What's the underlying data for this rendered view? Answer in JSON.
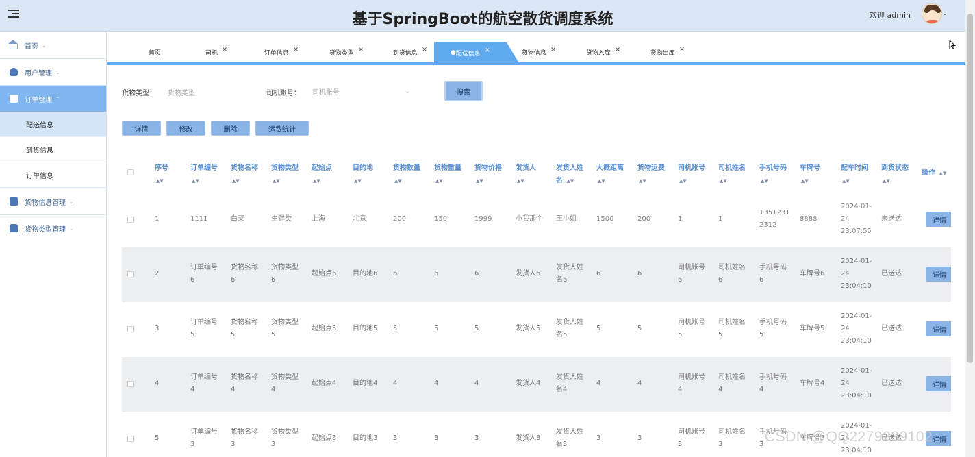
{
  "header": {
    "title": "基于SpringBoot的航空散货调度系统",
    "welcome": "欢迎 admin"
  },
  "sidebar": {
    "items": [
      {
        "label": "首页",
        "icon": "home-icon"
      },
      {
        "label": "用户管理",
        "icon": "user-icon"
      },
      {
        "label": "订单管理",
        "icon": "order-icon",
        "active": true,
        "children": [
          "配送信息",
          "到货信息",
          "订单信息"
        ]
      },
      {
        "label": "货物信息管理",
        "icon": "cargo-icon"
      },
      {
        "label": "货物类型管理",
        "icon": "type-icon"
      }
    ]
  },
  "tabs": [
    {
      "label": "首页",
      "closable": false
    },
    {
      "label": "司机",
      "closable": true
    },
    {
      "label": "订单信息",
      "closable": true
    },
    {
      "label": "货物类型",
      "closable": true
    },
    {
      "label": "到货信息",
      "closable": true
    },
    {
      "label": "配送信息",
      "closable": true,
      "active": true
    },
    {
      "label": "货物信息",
      "closable": true
    },
    {
      "label": "货物入库",
      "closable": true
    },
    {
      "label": "货物出库",
      "closable": true
    }
  ],
  "filters": {
    "cargo_type_label": "货物类型：",
    "cargo_type_placeholder": "货物类型",
    "driver_label": "司机账号：",
    "driver_placeholder": "司机账号",
    "search": "搜索"
  },
  "actions": {
    "detail": "详情",
    "edit": "修改",
    "delete": "删除",
    "stats": "运费统计"
  },
  "table": {
    "columns": [
      "序号",
      "订单编号",
      "货物名称",
      "货物类型",
      "起始点",
      "目的地",
      "货物数量",
      "货物重量",
      "货物价格",
      "发货人",
      "发货人姓名",
      "大概距离",
      "货物运费",
      "司机账号",
      "司机姓名",
      "手机号码",
      "车牌号",
      "配车时间",
      "到货状态",
      "操作"
    ],
    "row_button": "详情",
    "rows": [
      [
        "1",
        "1111",
        "白菜",
        "生鲜类",
        "上海",
        "北京",
        "200",
        "150",
        "1999",
        "小我那个",
        "王小姐",
        "1500",
        "200",
        "1",
        "1",
        "13512312312",
        "8888",
        "2024-01-24 23:07:55",
        "未送达"
      ],
      [
        "2",
        "订单编号6",
        "货物名称6",
        "货物类型6",
        "起始点6",
        "目的地6",
        "6",
        "6",
        "6",
        "发货人6",
        "发货人姓名6",
        "6",
        "6",
        "司机账号6",
        "司机姓名6",
        "手机号码6",
        "车牌号6",
        "2024-01-24 23:04:10",
        "已送达"
      ],
      [
        "3",
        "订单编号5",
        "货物名称5",
        "货物类型5",
        "起始点5",
        "目的地5",
        "5",
        "5",
        "5",
        "发货人5",
        "发货人姓名5",
        "5",
        "5",
        "司机账号5",
        "司机姓名5",
        "手机号码5",
        "车牌号5",
        "2024-01-24 23:04:10",
        "已送达"
      ],
      [
        "4",
        "订单编号4",
        "货物名称4",
        "货物类型4",
        "起始点4",
        "目的地4",
        "4",
        "4",
        "4",
        "发货人4",
        "发货人姓名4",
        "4",
        "4",
        "司机账号4",
        "司机姓名4",
        "手机号码4",
        "车牌号4",
        "2024-01-24 23:04:10",
        "已送达"
      ],
      [
        "5",
        "订单编号3",
        "货物名称3",
        "货物类型3",
        "起始点3",
        "目的地3",
        "3",
        "3",
        "3",
        "发货人3",
        "发货人姓名3",
        "3",
        "3",
        "司机账号3",
        "司机姓名3",
        "手机号码3",
        "车牌号3",
        "2024-01-24 23:04:10",
        "已送达"
      ]
    ]
  },
  "watermark": "CSDN @QQ2279239102"
}
